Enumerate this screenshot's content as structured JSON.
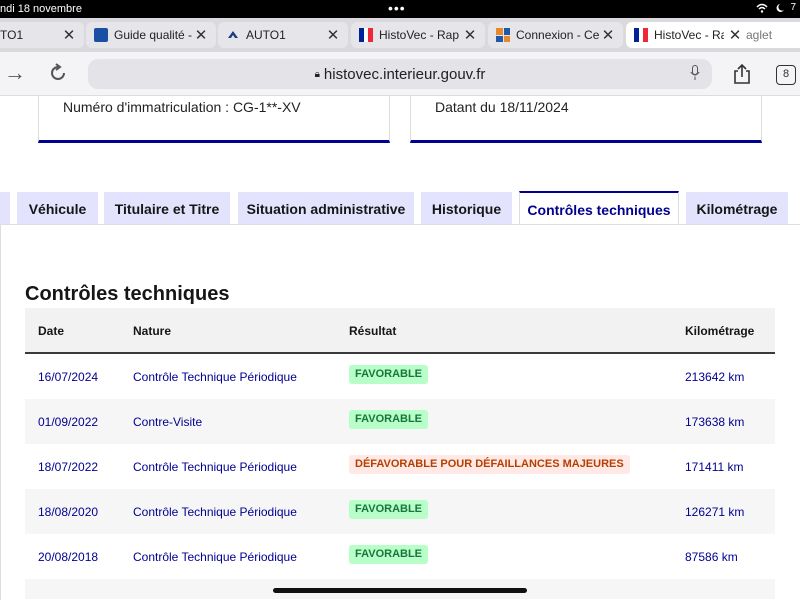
{
  "status": {
    "date": "ndi 18 novembre",
    "dots": "•••",
    "battery": "7"
  },
  "browser_tabs": [
    {
      "title": "TO1",
      "favicon": "none"
    },
    {
      "title": "Guide qualité -",
      "favicon": "doc-icon"
    },
    {
      "title": "AUTO1",
      "favicon": "auto1-logo-icon"
    },
    {
      "title": "HistoVec - Rap",
      "favicon": "french-flag-icon"
    },
    {
      "title": "Connexion - Ce",
      "favicon": "grid-logo-icon"
    },
    {
      "title": "HistoVec - Rapp",
      "favicon": "french-flag-icon",
      "suffix": "aglet",
      "active": true
    }
  ],
  "address_bar": {
    "url": "histovec.interieur.gouv.fr",
    "tabs_count": "8"
  },
  "cards": {
    "registration": "Numéro d'immatriculation : CG-1**-XV",
    "date": "Datant du 18/11/2024"
  },
  "section_tabs": [
    {
      "label": "Véhicule"
    },
    {
      "label": "Titulaire et Titre"
    },
    {
      "label": "Situation administrative"
    },
    {
      "label": "Historique"
    },
    {
      "label": "Contrôles techniques",
      "active": true
    },
    {
      "label": "Kilométrage"
    }
  ],
  "panel": {
    "title": "Contrôles techniques",
    "columns": {
      "date": "Date",
      "nature": "Nature",
      "result": "Résultat",
      "km": "Kilométrage"
    },
    "rows": [
      {
        "date": "16/07/2024",
        "nature": "Contrôle Technique Périodique",
        "result": "FAVORABLE",
        "status": "good",
        "km": "213642 km"
      },
      {
        "date": "01/09/2022",
        "nature": "Contre-Visite",
        "result": "FAVORABLE",
        "status": "good",
        "km": "173638 km"
      },
      {
        "date": "18/07/2022",
        "nature": "Contrôle Technique Périodique",
        "result": "DÉFAVORABLE POUR DÉFAILLANCES MAJEURES",
        "status": "bad",
        "km": "171411 km"
      },
      {
        "date": "18/08/2020",
        "nature": "Contrôle Technique Périodique",
        "result": "FAVORABLE",
        "status": "good",
        "km": "126271 km"
      },
      {
        "date": "20/08/2018",
        "nature": "Contrôle Technique Périodique",
        "result": "FAVORABLE",
        "status": "good",
        "km": "87586 km"
      }
    ]
  },
  "colors": {
    "primary": "#000091",
    "good_bg": "#b8fec9",
    "good_fg": "#18753c",
    "bad_bg": "#ffe9e6",
    "bad_fg": "#b34000",
    "tab_bg": "#e3e3fd"
  }
}
